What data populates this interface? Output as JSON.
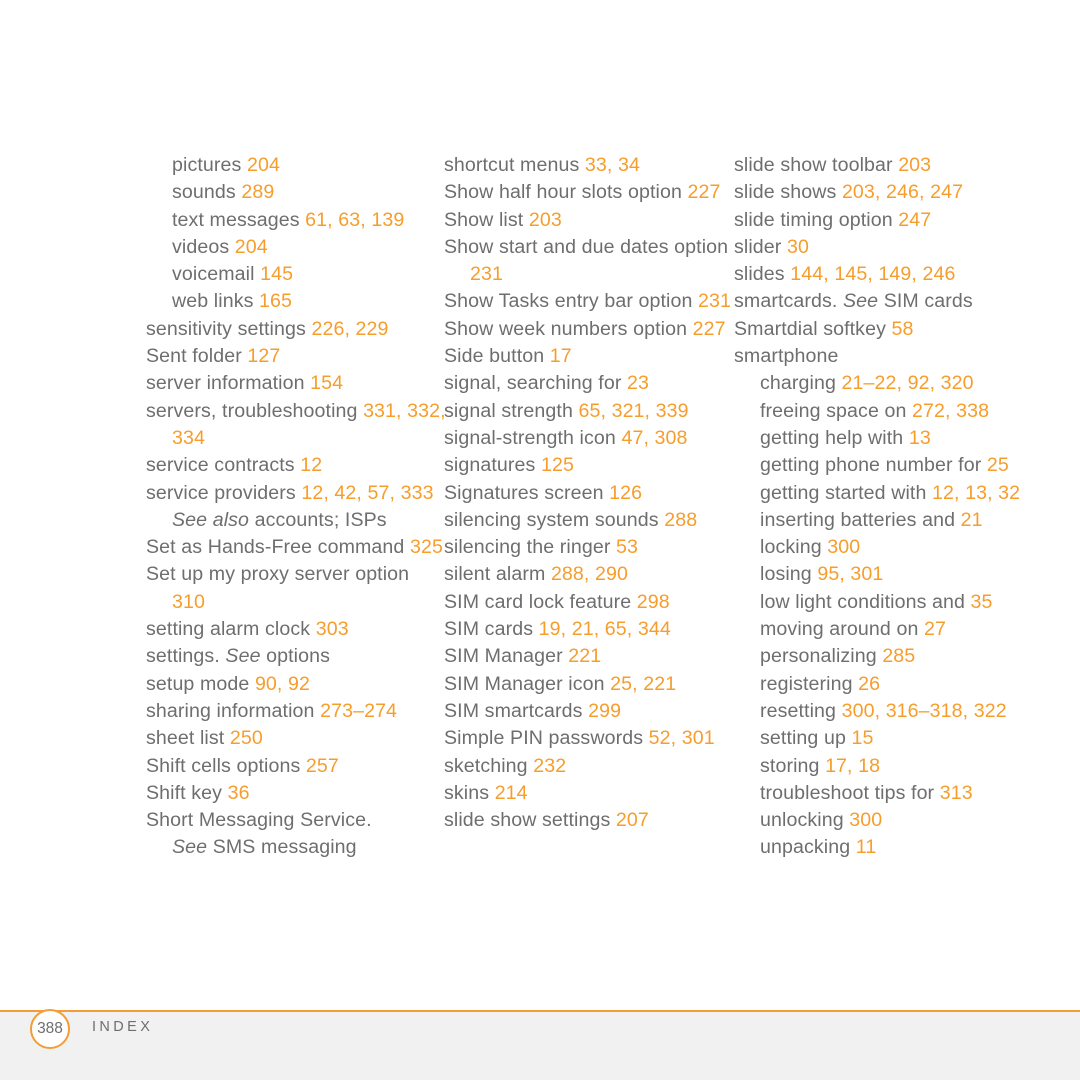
{
  "document": {
    "type": "book-index-page",
    "page_number": "388",
    "footer_label": "INDEX",
    "accent_color": "#f79d2b",
    "rule_color": "#f29d35",
    "text_color": "#6e6e6e",
    "background_color": "#ffffff",
    "footer_band_color": "#f1f1f1"
  },
  "columns": [
    {
      "id": "column-1",
      "entries": [
        {
          "level": 1,
          "term": "pictures ",
          "pages": "204"
        },
        {
          "level": 1,
          "term": "sounds ",
          "pages": "289"
        },
        {
          "level": 1,
          "term": "text messages ",
          "pages": "61, 63, 139"
        },
        {
          "level": 1,
          "term": "videos ",
          "pages": "204"
        },
        {
          "level": 1,
          "term": "voicemail ",
          "pages": "145"
        },
        {
          "level": 1,
          "term": "web links ",
          "pages": "165"
        },
        {
          "level": 0,
          "term": "sensitivity settings ",
          "pages": "226, 229"
        },
        {
          "level": 0,
          "term": "Sent folder ",
          "pages": "127"
        },
        {
          "level": 0,
          "term": "server information ",
          "pages": "154"
        },
        {
          "level": 0,
          "term": "servers, troubleshooting ",
          "pages": "331, 332, 334"
        },
        {
          "level": 0,
          "term": "service contracts ",
          "pages": "12"
        },
        {
          "level": 0,
          "term": "service providers ",
          "pages": "12, 42, 57, 333"
        },
        {
          "level": "xref",
          "see": "See also",
          "term": " accounts; ISPs",
          "pages": ""
        },
        {
          "level": 0,
          "term": "Set as Hands-Free command ",
          "pages": "325"
        },
        {
          "level": 0,
          "term": "Set up my proxy server option ",
          "pages": "310"
        },
        {
          "level": 0,
          "term": "setting alarm clock ",
          "pages": "303"
        },
        {
          "level": 0,
          "term": "settings. ",
          "see": "See",
          "term2": " options",
          "pages": ""
        },
        {
          "level": 0,
          "term": "setup mode ",
          "pages": "90, 92"
        },
        {
          "level": 0,
          "term": "sharing information ",
          "pages": "273–274"
        },
        {
          "level": 0,
          "term": "sheet list ",
          "pages": "250"
        },
        {
          "level": 0,
          "term": "Shift cells options ",
          "pages": "257"
        },
        {
          "level": 0,
          "term": "Shift key ",
          "pages": "36"
        },
        {
          "level": 0,
          "term": "Short Messaging Service.",
          "pages": ""
        },
        {
          "level": "xref",
          "see": "See",
          "term": " SMS messaging",
          "pages": ""
        }
      ]
    },
    {
      "id": "column-2",
      "entries": [
        {
          "level": 0,
          "term": "shortcut menus ",
          "pages": "33, 34"
        },
        {
          "level": 0,
          "term": "Show half hour slots option ",
          "pages": "227"
        },
        {
          "level": 0,
          "term": "Show list ",
          "pages": "203"
        },
        {
          "level": 0,
          "term": "Show start and due dates option ",
          "pages": "231"
        },
        {
          "level": 0,
          "term": "Show Tasks entry bar option ",
          "pages": "231"
        },
        {
          "level": 0,
          "term": "Show week numbers option ",
          "pages": "227"
        },
        {
          "level": 0,
          "term": "Side button ",
          "pages": "17"
        },
        {
          "level": 0,
          "term": "signal, searching for ",
          "pages": "23"
        },
        {
          "level": 0,
          "term": "signal strength ",
          "pages": "65, 321, 339"
        },
        {
          "level": 0,
          "term": "signal-strength icon ",
          "pages": "47, 308"
        },
        {
          "level": 0,
          "term": "signatures ",
          "pages": "125"
        },
        {
          "level": 0,
          "term": "Signatures screen ",
          "pages": "126"
        },
        {
          "level": 0,
          "term": "silencing system sounds ",
          "pages": "288"
        },
        {
          "level": 0,
          "term": "silencing the ringer ",
          "pages": "53"
        },
        {
          "level": 0,
          "term": "silent alarm ",
          "pages": "288, 290"
        },
        {
          "level": 0,
          "term": "SIM card lock feature ",
          "pages": "298"
        },
        {
          "level": 0,
          "term": "SIM cards ",
          "pages": "19, 21, 65, 344"
        },
        {
          "level": 0,
          "term": "SIM Manager ",
          "pages": "221"
        },
        {
          "level": 0,
          "term": "SIM Manager icon ",
          "pages": "25, 221"
        },
        {
          "level": 0,
          "term": "SIM smartcards ",
          "pages": "299"
        },
        {
          "level": 0,
          "term": "Simple PIN passwords ",
          "pages": "52, 301"
        },
        {
          "level": 0,
          "term": "sketching ",
          "pages": "232"
        },
        {
          "level": 0,
          "term": "skins ",
          "pages": "214"
        },
        {
          "level": 0,
          "term": "slide show settings ",
          "pages": "207"
        }
      ]
    },
    {
      "id": "column-3",
      "entries": [
        {
          "level": 0,
          "term": "slide show toolbar ",
          "pages": "203"
        },
        {
          "level": 0,
          "term": "slide shows ",
          "pages": "203, 246, 247"
        },
        {
          "level": 0,
          "term": "slide timing option ",
          "pages": "247"
        },
        {
          "level": 0,
          "term": "slider ",
          "pages": "30"
        },
        {
          "level": 0,
          "term": "slides ",
          "pages": "144, 145, 149, 246"
        },
        {
          "level": 0,
          "term": "smartcards. ",
          "see": "See",
          "term2": " SIM cards",
          "pages": ""
        },
        {
          "level": 0,
          "term": "Smartdial softkey ",
          "pages": "58"
        },
        {
          "level": 0,
          "term": "smartphone",
          "pages": ""
        },
        {
          "level": 1,
          "term": "charging ",
          "pages": "21–22, 92, 320"
        },
        {
          "level": 1,
          "term": "freeing space on ",
          "pages": "272, 338"
        },
        {
          "level": 1,
          "term": "getting help with ",
          "pages": "13"
        },
        {
          "level": 1,
          "term": "getting phone number for ",
          "pages": "25"
        },
        {
          "level": 1,
          "term": "getting started with ",
          "pages": "12, 13, 32"
        },
        {
          "level": 1,
          "term": "inserting batteries and ",
          "pages": "21"
        },
        {
          "level": 1,
          "term": "locking ",
          "pages": "300"
        },
        {
          "level": 1,
          "term": "losing ",
          "pages": "95, 301"
        },
        {
          "level": 1,
          "term": "low light conditions and ",
          "pages": "35"
        },
        {
          "level": 1,
          "term": "moving around on ",
          "pages": "27"
        },
        {
          "level": 1,
          "term": "personalizing ",
          "pages": "285"
        },
        {
          "level": 1,
          "term": "registering ",
          "pages": "26"
        },
        {
          "level": 1,
          "term": "resetting ",
          "pages": "300, 316–318, 322"
        },
        {
          "level": 1,
          "term": "setting up ",
          "pages": "15"
        },
        {
          "level": 1,
          "term": "storing ",
          "pages": "17, 18"
        },
        {
          "level": 1,
          "term": "troubleshoot tips for ",
          "pages": "313"
        },
        {
          "level": 1,
          "term": "unlocking ",
          "pages": "300"
        },
        {
          "level": 1,
          "term": "unpacking ",
          "pages": "11"
        }
      ]
    }
  ]
}
